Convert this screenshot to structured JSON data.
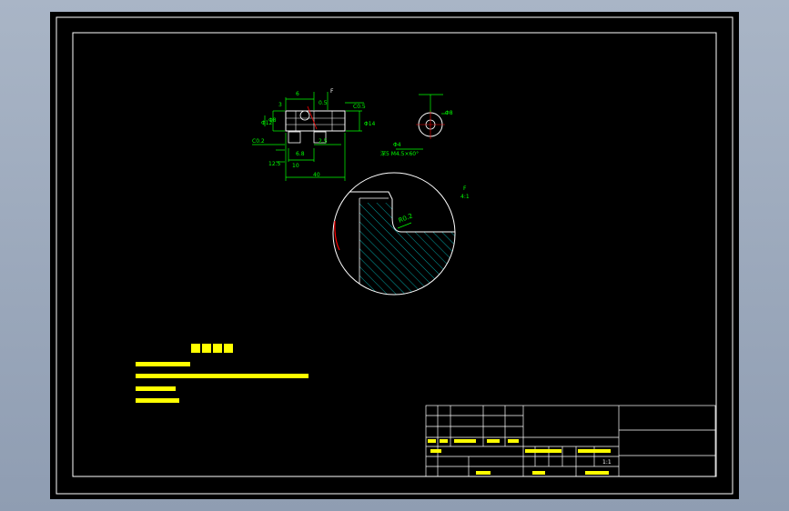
{
  "title_block": {
    "scale_value": "1:1"
  },
  "drawing": {
    "detail_view": {
      "label": "F",
      "scale": "4:1",
      "radius_label": "R0.2"
    },
    "main_view": {
      "section_mark": "F",
      "dims": {
        "top": "6",
        "top_small": "0.5",
        "chamfer": "C0.5",
        "left_dia": "Φ12",
        "left_dia2": "Φ8",
        "left_chamfer": "C0.2",
        "right_dia": "Φ14",
        "mid": "2.5",
        "bot_small": "6.8",
        "bot": "10",
        "bot_left": "12.5",
        "overall": "40",
        "small_r": "3"
      }
    },
    "side_view": {
      "dia": "Φ8",
      "hole": "Φ4",
      "note": "深5 M4.5×60°"
    },
    "colors": {
      "geometry": "#ffffff",
      "dimension": "#00ff00",
      "hatch": "#00b4b4",
      "text": "#ffff00",
      "accent": "#ff0000"
    }
  }
}
